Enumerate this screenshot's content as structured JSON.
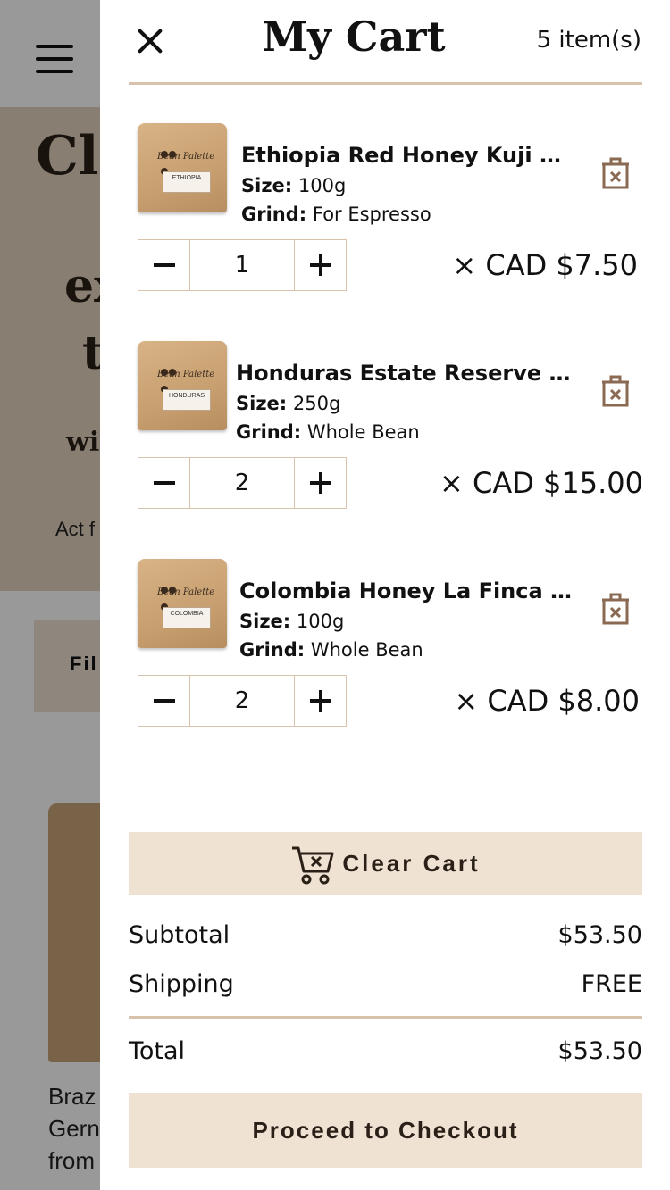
{
  "background": {
    "hero_title": "Cla",
    "hero_line2": "ex",
    "hero_line3": "t",
    "hero_sub": "wi",
    "hero_note": "Act f",
    "filter_label": "Fil",
    "product_lines": [
      "Braz",
      "Gern",
      "from"
    ]
  },
  "cart": {
    "title": "My Cart",
    "item_count": "5 item(s)",
    "size_label": "Size:",
    "grind_label": "Grind:",
    "price_prefix": "× CAD ",
    "items": [
      {
        "name": "Ethiopia Red Honey Kuji M...",
        "bag_label": "ETHIOPIA",
        "size": "100g",
        "grind": "For Espresso",
        "quantity": "1",
        "price": "$7.50"
      },
      {
        "name": "Honduras Estate Reserve H...",
        "bag_label": "HONDURAS",
        "size": "250g",
        "grind": "Whole Bean",
        "quantity": "2",
        "price": "$15.00"
      },
      {
        "name": "Colombia Honey La Finca M...",
        "bag_label": "COLOMBIA",
        "size": "100g",
        "grind": "Whole Bean",
        "quantity": "2",
        "price": "$8.00"
      }
    ],
    "bag_brand": "Bean Palette",
    "clear_cart_label": "Clear Cart",
    "subtotal_label": "Subtotal",
    "subtotal_value": "$53.50",
    "shipping_label": "Shipping",
    "shipping_value": "FREE",
    "total_label": "Total",
    "total_value": "$53.50",
    "checkout_label": "Proceed to Checkout"
  },
  "colors": {
    "accent_beige": "#efe2d2",
    "divider": "#d8c2ac",
    "trash_brown": "#8a6a52"
  }
}
